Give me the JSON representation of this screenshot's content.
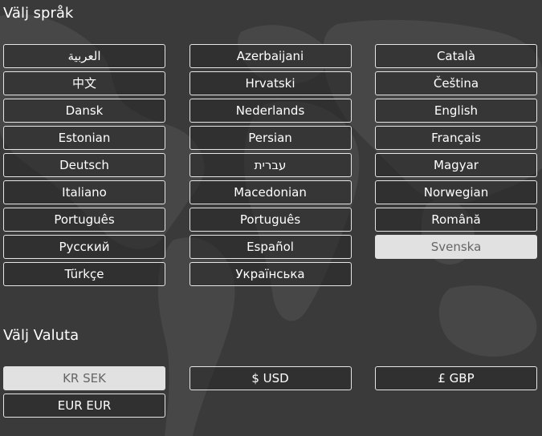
{
  "language_section": {
    "title": "Välj språk",
    "options": [
      {
        "label": "العربية",
        "selected": false
      },
      {
        "label": "Azerbaijani",
        "selected": false
      },
      {
        "label": "Català",
        "selected": false
      },
      {
        "label": "中文",
        "selected": false
      },
      {
        "label": "Hrvatski",
        "selected": false
      },
      {
        "label": "Čeština",
        "selected": false
      },
      {
        "label": "Dansk",
        "selected": false
      },
      {
        "label": "Nederlands",
        "selected": false
      },
      {
        "label": "English",
        "selected": false
      },
      {
        "label": "Estonian",
        "selected": false
      },
      {
        "label": "Persian",
        "selected": false
      },
      {
        "label": "Français",
        "selected": false
      },
      {
        "label": "Deutsch",
        "selected": false
      },
      {
        "label": "עברית",
        "selected": false
      },
      {
        "label": "Magyar",
        "selected": false
      },
      {
        "label": "Italiano",
        "selected": false
      },
      {
        "label": "Macedonian",
        "selected": false
      },
      {
        "label": "Norwegian",
        "selected": false
      },
      {
        "label": "Português",
        "selected": false
      },
      {
        "label": "Português",
        "selected": false
      },
      {
        "label": "Română",
        "selected": false
      },
      {
        "label": "Русский",
        "selected": false
      },
      {
        "label": "Español",
        "selected": false
      },
      {
        "label": "Svenska",
        "selected": true
      },
      {
        "label": "Türkçe",
        "selected": false
      },
      {
        "label": "Українська",
        "selected": false
      }
    ]
  },
  "currency_section": {
    "title": "Välj Valuta",
    "options": [
      {
        "label": "KR SEK",
        "selected": true
      },
      {
        "label": "$ USD",
        "selected": false
      },
      {
        "label": "£ GBP",
        "selected": false
      },
      {
        "label": "EUR EUR",
        "selected": false
      }
    ]
  },
  "colors": {
    "background": "#3a3a3a",
    "map_land": "#474747",
    "button_border": "#e6e6e6",
    "selected_bg": "#e1e1e1",
    "selected_text": "#666666",
    "text": "#ffffff"
  }
}
